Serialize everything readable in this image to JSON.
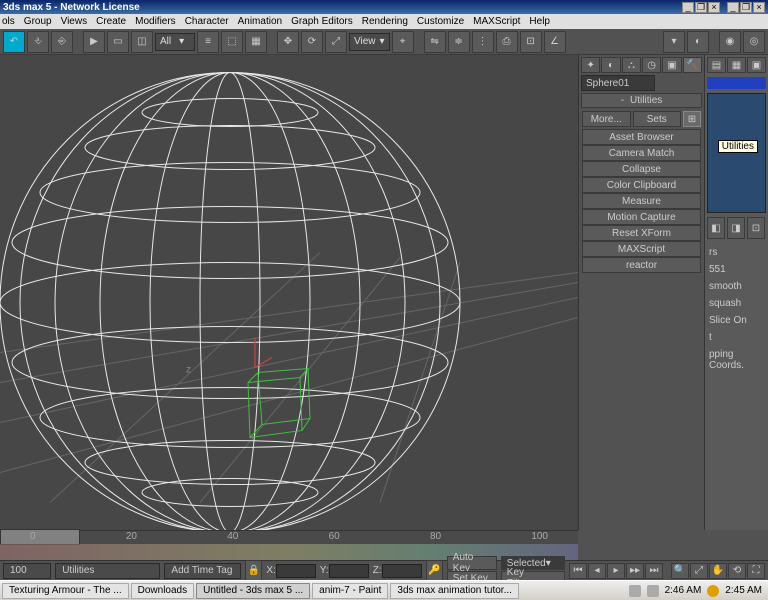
{
  "title": "3ds max 5 - Network License",
  "menus": [
    "ols",
    "Group",
    "Views",
    "Create",
    "Modifiers",
    "Character",
    "Animation",
    "Graph Editors",
    "Rendering",
    "Customize",
    "MAXScript",
    "Help"
  ],
  "toolbar": {
    "sel_filter": "All",
    "view": "View"
  },
  "object_name": "Sphere01",
  "tooltip": "Utilities",
  "utilities": {
    "header": "Utilities",
    "more": "More...",
    "sets": "Sets",
    "items": [
      "Asset Browser",
      "Camera Match",
      "Collapse",
      "Color Clipboard",
      "Measure",
      "Motion Capture",
      "Reset XForm",
      "MAXScript",
      "reactor"
    ]
  },
  "right_strip": {
    "rs_label": "rs",
    "num": "551",
    "smooth": "smooth",
    "squash": "squash",
    "slice": "Slice On",
    "t": "t",
    "mapping": "pping Coords."
  },
  "time": {
    "frame_start": "0",
    "frame_end": "100",
    "status_left": "100",
    "status_right": "Utilities",
    "add_time_tag": "Add Time Tag",
    "x": "X:",
    "y": "Y:",
    "z": "Z:",
    "autokey": "Auto Key",
    "setkey": "Set Key",
    "selected": "Selected",
    "key_filters": "Key Filters..."
  },
  "taskbar": {
    "items": [
      "Texturing Armour - The ...",
      "Downloads",
      "Untitled - 3ds max 5 ...",
      "anim-7 - Paint",
      "3ds max animation tutor..."
    ],
    "clock1": "2:46 AM",
    "clock2": "2:45 AM"
  }
}
